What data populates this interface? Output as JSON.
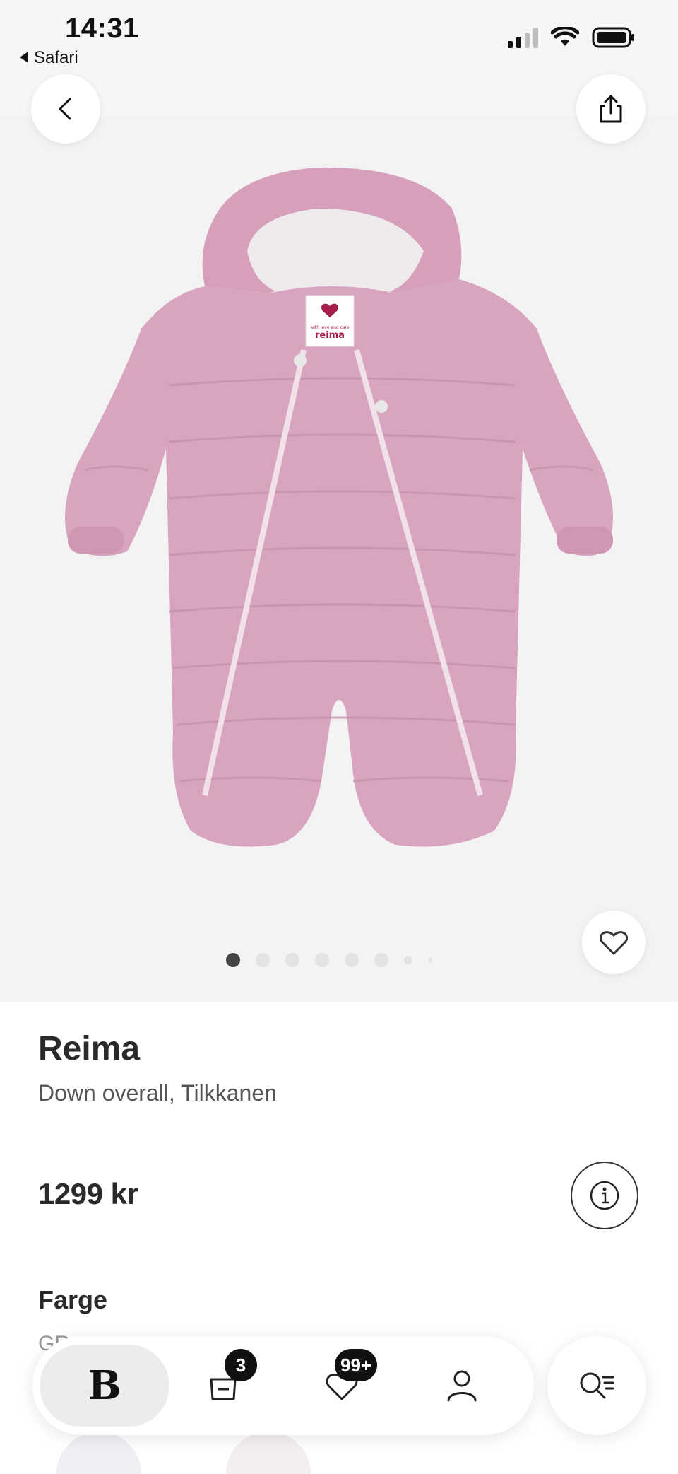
{
  "status_bar": {
    "time": "14:31",
    "back_app_label": "Safari"
  },
  "product": {
    "brand": "Reima",
    "name": "Down overall, Tilkkanen",
    "price": "1299 kr",
    "label_brand": "reima",
    "label_tagline": "with love and care"
  },
  "colors": {
    "garment": "#d9a4bf",
    "garment_shadow": "#c98fae",
    "accent": "#a61e4d"
  },
  "gallery": {
    "total_images": 8,
    "active_index": 0
  },
  "color_section": {
    "heading": "Farge",
    "value": "GR"
  },
  "nav": {
    "home_logo": "B",
    "bag_count": "3",
    "favorites_count": "99+"
  },
  "icons": {
    "back": "chevron-left-icon",
    "share": "share-icon",
    "favorite": "heart-icon",
    "info": "info-icon",
    "bag": "bag-icon",
    "profile": "person-icon",
    "search": "search-list-icon"
  }
}
